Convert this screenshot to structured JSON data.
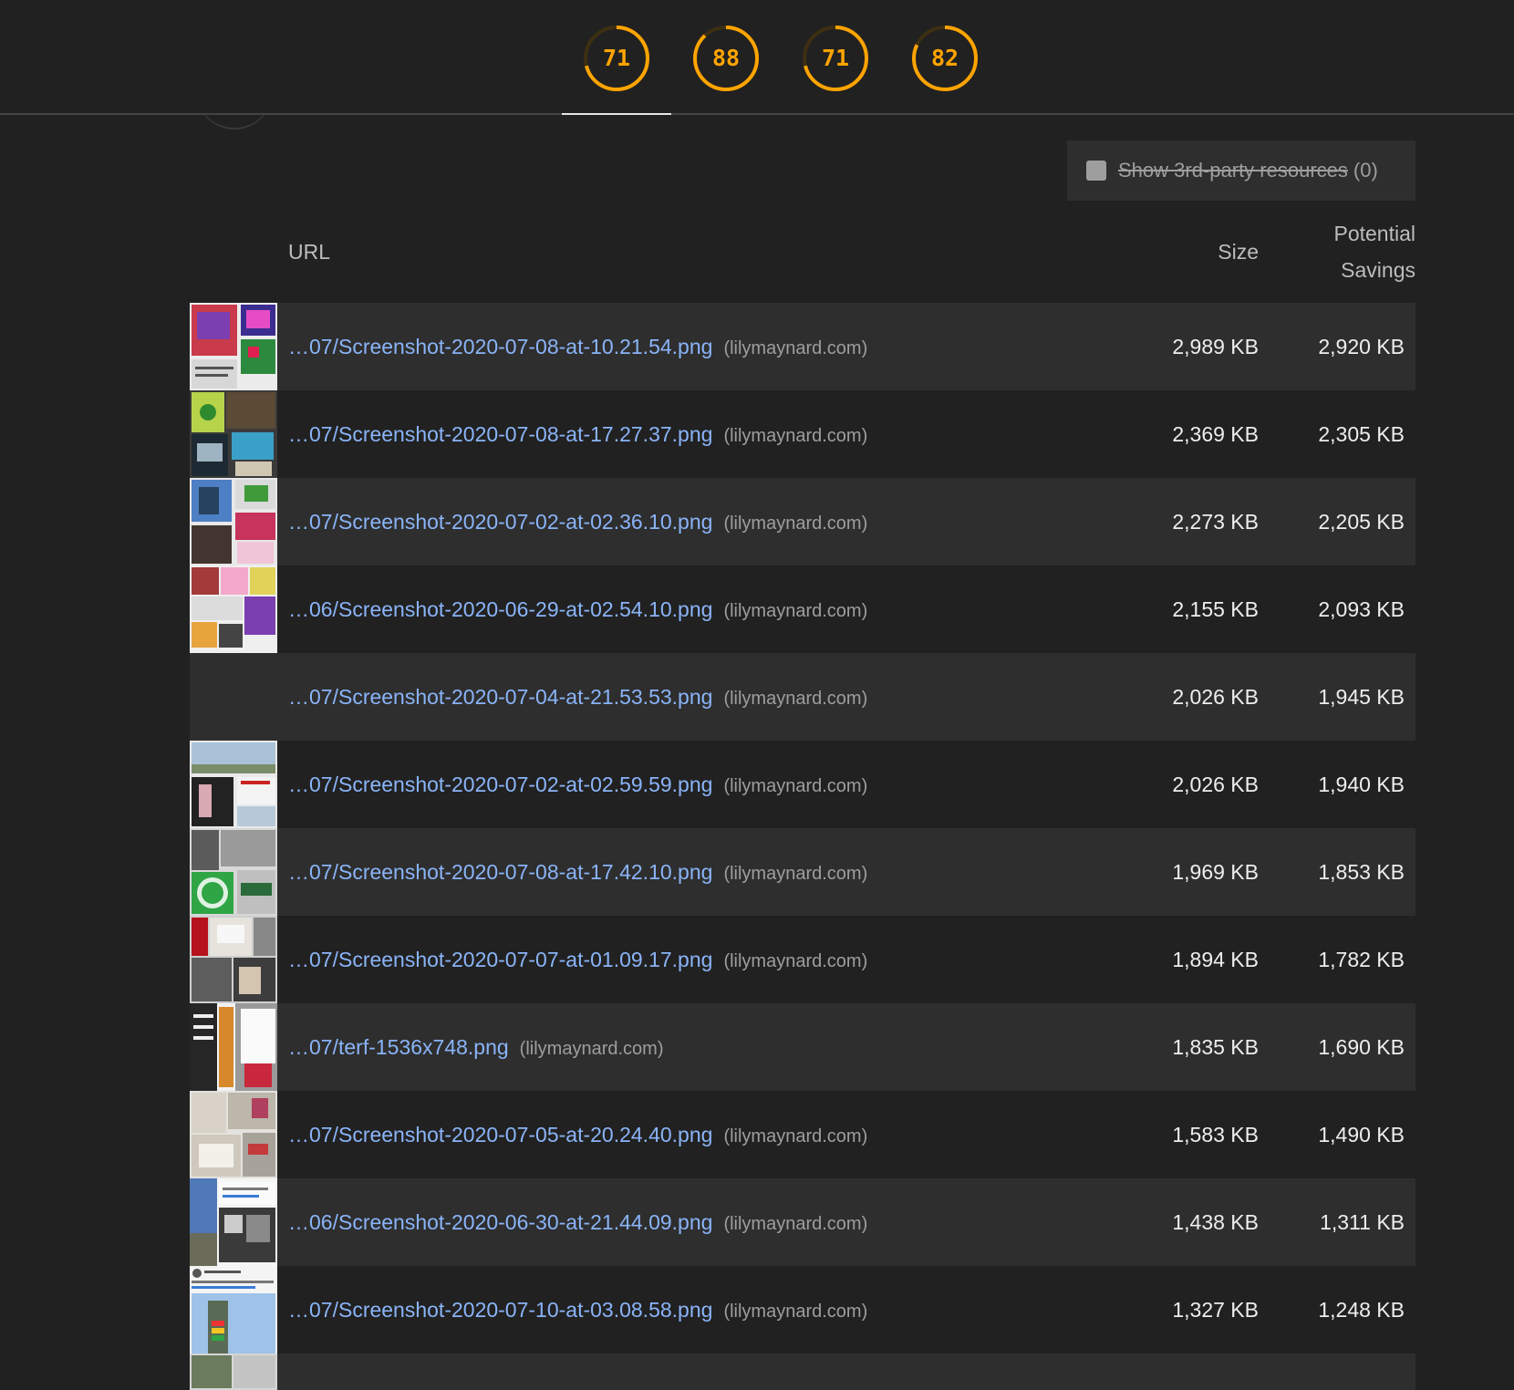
{
  "scores": [
    {
      "label": "71",
      "value": 71
    },
    {
      "label": "88",
      "value": 88
    },
    {
      "label": "71",
      "value": 71
    },
    {
      "label": "82",
      "value": 82
    }
  ],
  "colors": {
    "score_average": "#ffa400",
    "link": "#8ab4f8",
    "background": "#212121",
    "row_alt": "#2e2e2e"
  },
  "filter": {
    "label": "Show 3rd-party resources",
    "count": "(0)",
    "checked": false
  },
  "table": {
    "headers": {
      "url": "URL",
      "size": "Size",
      "savings_line1": "Potential",
      "savings_line2": "Savings"
    },
    "rows": [
      {
        "path": "…07/Screenshot-2020-07-08-at-10.21.54.png",
        "host": "(lilymaynard.com)",
        "size": "2,989 KB",
        "savings": "2,920 KB"
      },
      {
        "path": "…07/Screenshot-2020-07-08-at-17.27.37.png",
        "host": "(lilymaynard.com)",
        "size": "2,369 KB",
        "savings": "2,305 KB"
      },
      {
        "path": "…07/Screenshot-2020-07-02-at-02.36.10.png",
        "host": "(lilymaynard.com)",
        "size": "2,273 KB",
        "savings": "2,205 KB"
      },
      {
        "path": "…06/Screenshot-2020-06-29-at-02.54.10.png",
        "host": "(lilymaynard.com)",
        "size": "2,155 KB",
        "savings": "2,093 KB"
      },
      {
        "path": "…07/Screenshot-2020-07-04-at-21.53.53.png",
        "host": "(lilymaynard.com)",
        "size": "2,026 KB",
        "savings": "1,945 KB"
      },
      {
        "path": "…07/Screenshot-2020-07-02-at-02.59.59.png",
        "host": "(lilymaynard.com)",
        "size": "2,026 KB",
        "savings": "1,940 KB"
      },
      {
        "path": "…07/Screenshot-2020-07-08-at-17.42.10.png",
        "host": "(lilymaynard.com)",
        "size": "1,969 KB",
        "savings": "1,853 KB"
      },
      {
        "path": "…07/Screenshot-2020-07-07-at-01.09.17.png",
        "host": "(lilymaynard.com)",
        "size": "1,894 KB",
        "savings": "1,782 KB"
      },
      {
        "path": "…07/terf-1536x748.png",
        "host": "(lilymaynard.com)",
        "size": "1,835 KB",
        "savings": "1,690 KB"
      },
      {
        "path": "…07/Screenshot-2020-07-05-at-20.24.40.png",
        "host": "(lilymaynard.com)",
        "size": "1,583 KB",
        "savings": "1,490 KB"
      },
      {
        "path": "…06/Screenshot-2020-06-30-at-21.44.09.png",
        "host": "(lilymaynard.com)",
        "size": "1,438 KB",
        "savings": "1,311 KB"
      },
      {
        "path": "…07/Screenshot-2020-07-10-at-03.08.58.png",
        "host": "(lilymaynard.com)",
        "size": "1,327 KB",
        "savings": "1,248 KB"
      }
    ]
  }
}
